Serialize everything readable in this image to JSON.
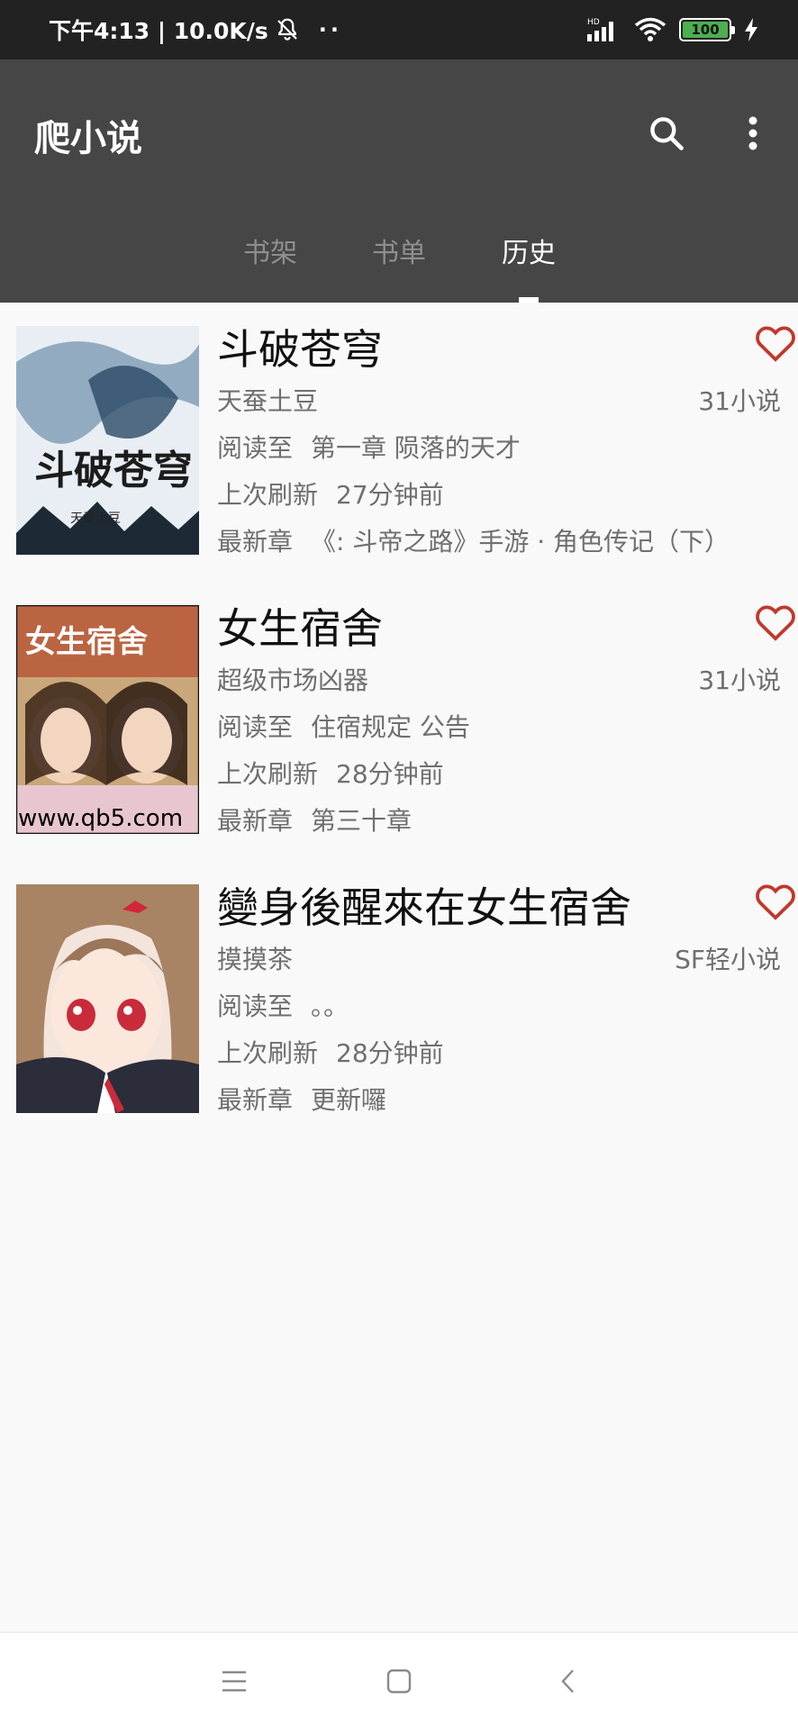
{
  "status_bar": {
    "time_speed": "下午4:13 | 10.0K/s",
    "dots": "··",
    "network": "HD",
    "battery": "100"
  },
  "app_bar": {
    "title": "爬小说",
    "icons": [
      "search-icon",
      "more-vert-icon"
    ]
  },
  "tabs": [
    {
      "label": "书架",
      "active": false
    },
    {
      "label": "书单",
      "active": false
    },
    {
      "label": "历史",
      "active": true
    }
  ],
  "books": [
    {
      "title": "斗破苍穹",
      "author": "天蚕土豆",
      "source": "31小说",
      "read_label": "阅读至",
      "read_value": "第一章 陨落的天才",
      "refresh_label": "上次刷新",
      "refresh_value": "27分钟前",
      "latest_label": "最新章",
      "latest_value": "《: 斗帝之路》手游 · 角色传记（下）",
      "cover_text": "斗破苍穹",
      "cover_sub": "天蚕土豆"
    },
    {
      "title": "女生宿舍",
      "author": "超级市场凶器",
      "source": "31小说",
      "read_label": "阅读至",
      "read_value": "住宿规定 公告",
      "refresh_label": "上次刷新",
      "refresh_value": "28分钟前",
      "latest_label": "最新章",
      "latest_value": "第三十章",
      "cover_text": "女生宿舍",
      "cover_sub": "www.qb5.com"
    },
    {
      "title": "變身後醒來在女生宿舍",
      "author": "摸摸茶",
      "source": "SF轻小说",
      "read_label": "阅读至",
      "read_value": "。。",
      "refresh_label": "上次刷新",
      "refresh_value": "28分钟前",
      "latest_label": "最新章",
      "latest_value": "更新囉"
    }
  ],
  "colors": {
    "status_bar": "#222222",
    "app_bar": "#464646",
    "heart": "#c0392b",
    "background": "#f9f9f9"
  }
}
